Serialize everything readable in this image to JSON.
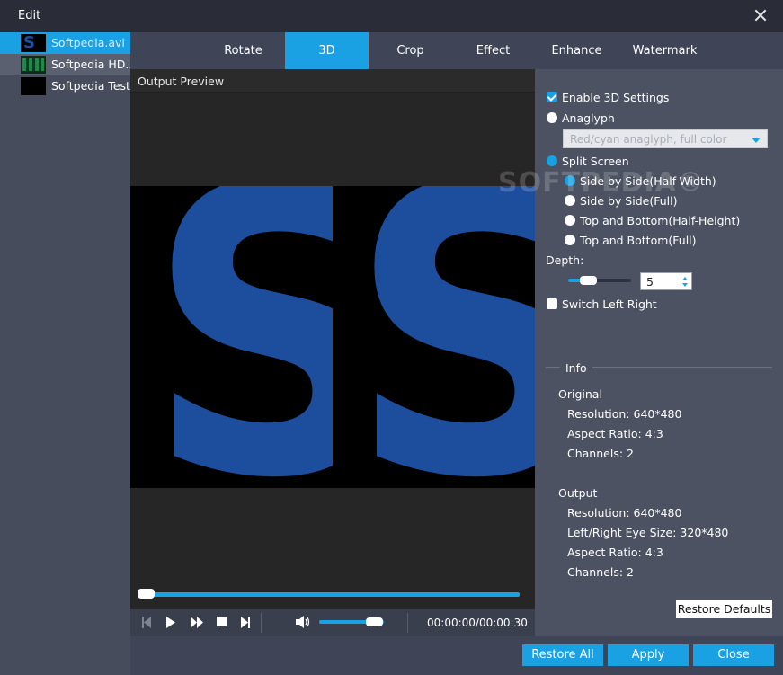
{
  "window": {
    "title": "Edit"
  },
  "files": [
    {
      "name": "Softpedia.avi",
      "thumb": "s-logo"
    },
    {
      "name": "Softpedia HD....",
      "thumb": "green-clip"
    },
    {
      "name": "Softpedia Test...",
      "thumb": "black"
    }
  ],
  "tabs": [
    "Rotate",
    "3D",
    "Crop",
    "Effect",
    "Enhance",
    "Watermark"
  ],
  "active_tab": "3D",
  "preview": {
    "label": "Output Preview",
    "frame_letter": "S",
    "seek_progress": 0.0,
    "volume_level": 0.85,
    "timecode": "00:00:00/00:00:30"
  },
  "settings": {
    "enable_3d_label": "Enable 3D Settings",
    "enable_3d_checked": true,
    "anaglyph_label": "Anaglyph",
    "anaglyph_selected": "Red/cyan anaglyph, full color",
    "split_screen_label": "Split Screen",
    "split_options": [
      "Side by Side(Half-Width)",
      "Side by Side(Full)",
      "Top and Bottom(Half-Height)",
      "Top and Bottom(Full)"
    ],
    "split_selected": "Side by Side(Half-Width)",
    "depth_label": "Depth:",
    "depth_value": "5",
    "depth_level": 0.3,
    "switch_lr_label": "Switch Left Right",
    "switch_lr_checked": false
  },
  "info": {
    "title": "Info",
    "original_title": "Original",
    "original": [
      "Resolution: 640*480",
      "Aspect Ratio: 4:3",
      "Channels: 2"
    ],
    "output_title": "Output",
    "output": [
      "Resolution: 640*480",
      "Left/Right Eye Size: 320*480",
      "Aspect Ratio: 4:3",
      "Channels: 2"
    ]
  },
  "buttons": {
    "restore_defaults": "Restore Defaults",
    "restore_all": "Restore All",
    "apply": "Apply",
    "close": "Close"
  },
  "watermark_text": "SOFTPEDIA®",
  "colors": {
    "accent": "#1aa1e3",
    "frame_logo": "#1d4e9e"
  }
}
